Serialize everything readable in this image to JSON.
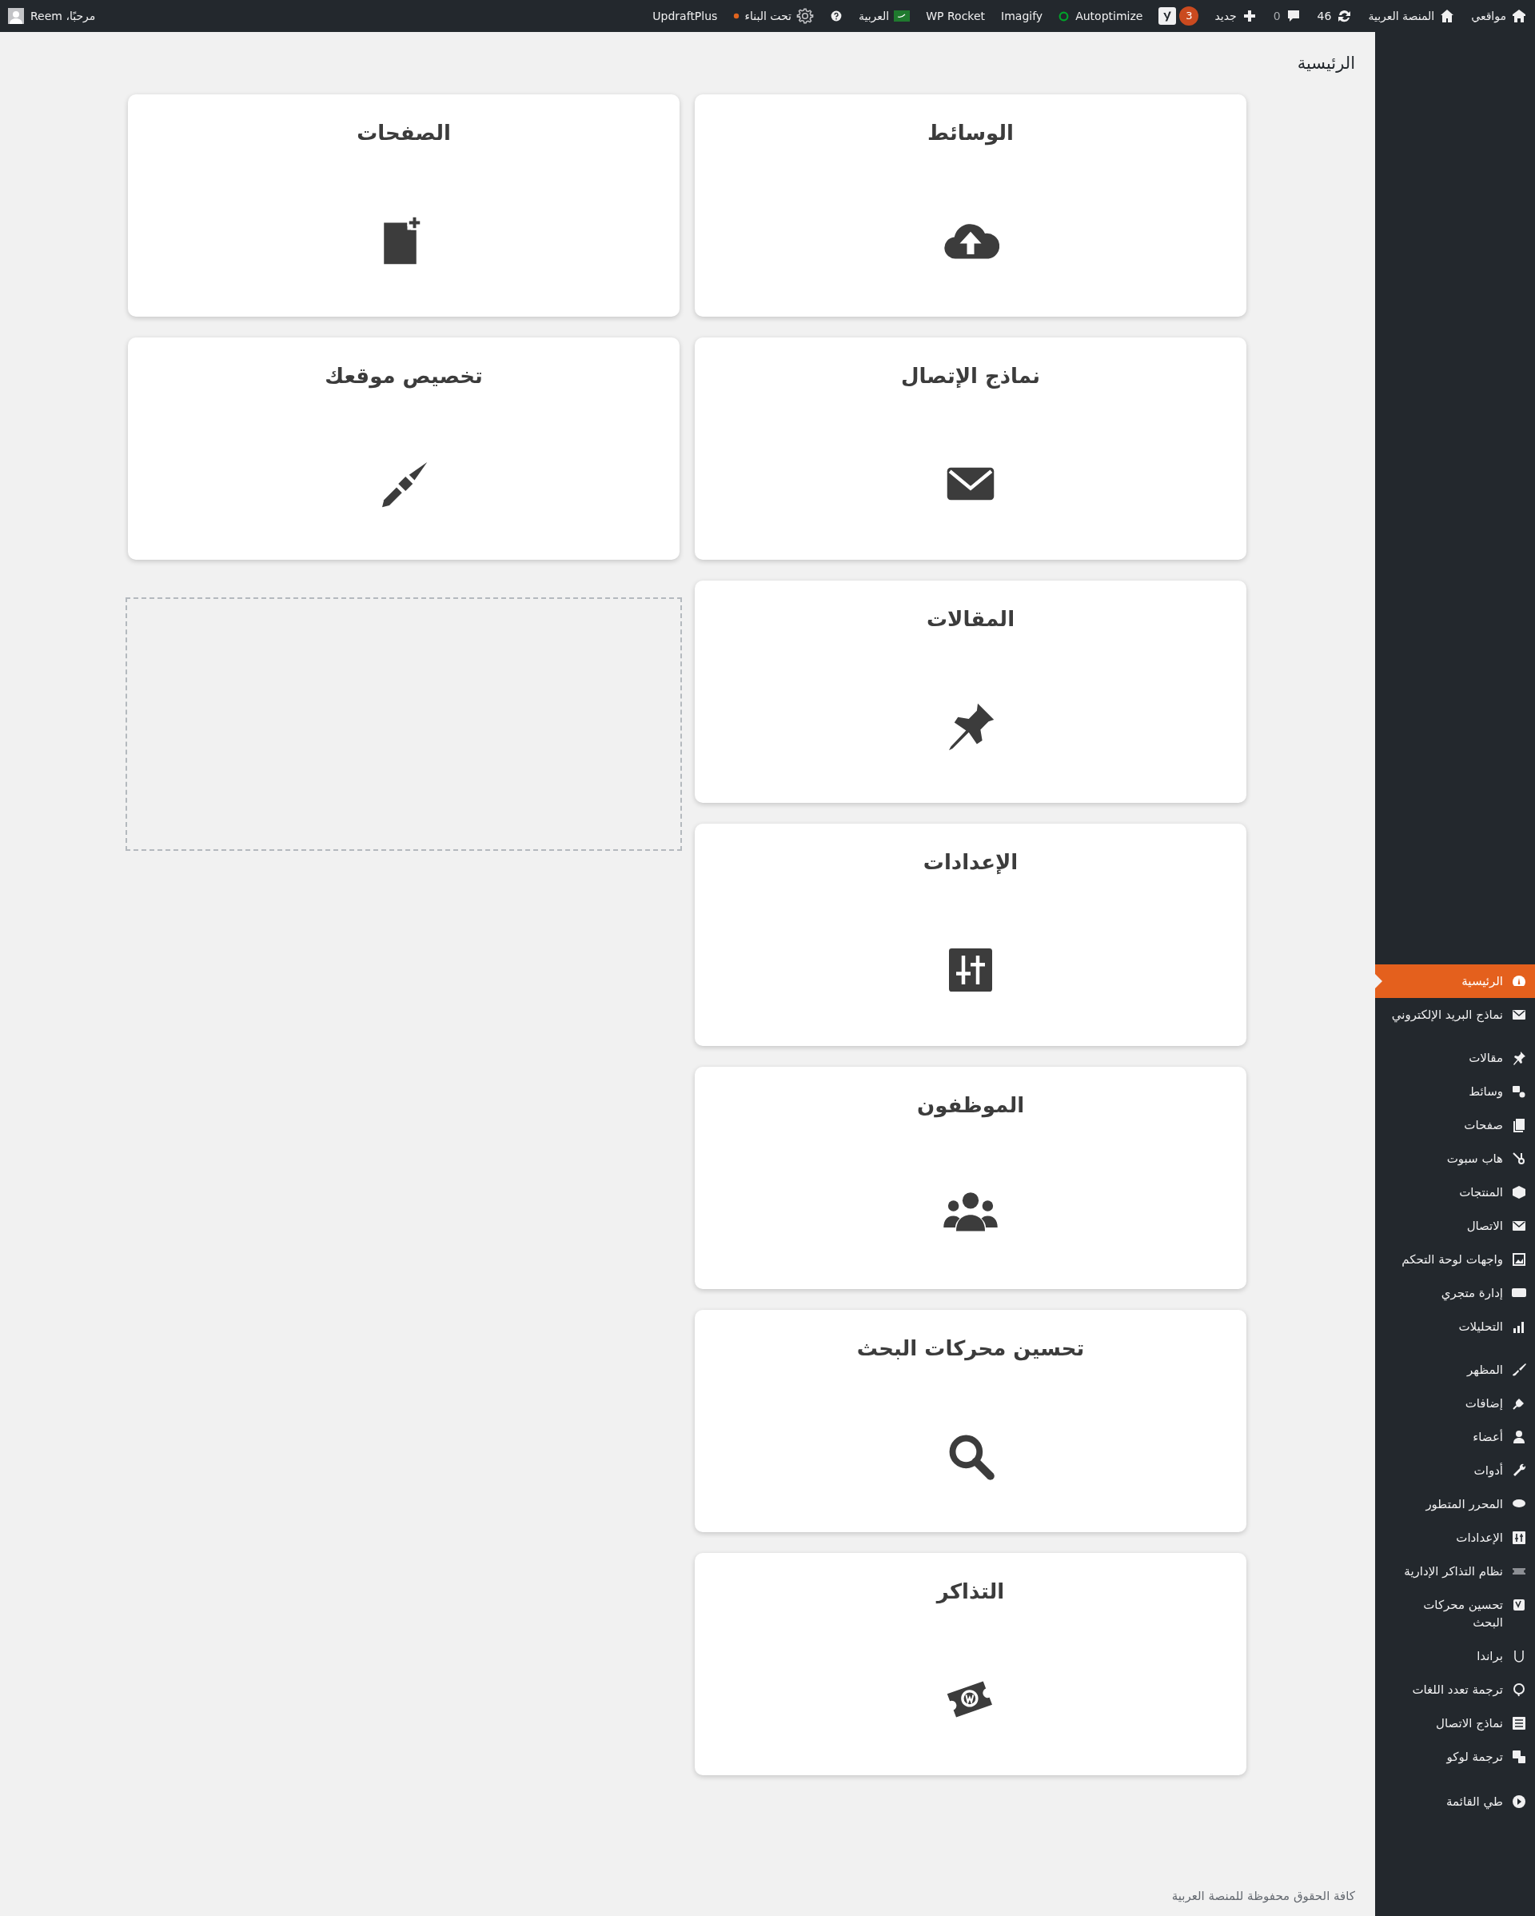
{
  "admin_bar": {
    "items": [
      {
        "kind": "menu",
        "label": "مواقعي"
      },
      {
        "kind": "menu",
        "label": "المنصة العربية"
      },
      {
        "kind": "menu",
        "label": "46"
      },
      {
        "kind": "menu",
        "label": "0"
      },
      {
        "kind": "menu",
        "label": "جديد"
      },
      {
        "kind": "badge",
        "label": "3"
      },
      {
        "kind": "status",
        "label": "Autoptimize"
      },
      {
        "kind": "menu",
        "label": "Imagify"
      },
      {
        "kind": "menu",
        "label": "WP Rocket"
      },
      {
        "kind": "flag",
        "label": "العربية"
      },
      {
        "kind": "help"
      },
      {
        "kind": "dot",
        "label": "تحت البناء"
      },
      {
        "kind": "menu",
        "label": "UpdraftPlus"
      }
    ],
    "account": "مرحبًا، Reem"
  },
  "sidebar": {
    "groups": [
      [
        {
          "label": "الرئيسية",
          "selected": true
        },
        {
          "label": "نماذج البريد الإلكتروني",
          "selected": false
        }
      ],
      [
        {
          "label": "مقالات",
          "selected": false
        },
        {
          "label": "وسائط",
          "selected": false
        },
        {
          "label": "صفحات",
          "selected": false
        },
        {
          "label": "هاب سبوت",
          "selected": false
        },
        {
          "label": "المنتجات",
          "selected": false
        },
        {
          "label": "الاتصال",
          "selected": false
        },
        {
          "label": "واجهات لوحة التحكم",
          "selected": false
        },
        {
          "label": "إدارة متجري",
          "selected": false
        },
        {
          "label": "التحليلات",
          "selected": false
        }
      ],
      [
        {
          "label": "المظهر",
          "selected": false
        },
        {
          "label": "إضافات",
          "selected": false
        },
        {
          "label": "أعضاء",
          "selected": false
        },
        {
          "label": "أدوات",
          "selected": false
        },
        {
          "label": "المحرر المتطور",
          "selected": false
        },
        {
          "label": "الإعدادات",
          "selected": false
        },
        {
          "label": "نظام التذاكر الإدارية",
          "selected": false
        },
        {
          "label": "تحسين محركات البحث",
          "selected": false
        },
        {
          "label": "براندا",
          "selected": false
        },
        {
          "label": "ترجمة تعدد اللغات",
          "selected": false
        },
        {
          "label": "نماذج الاتصال",
          "selected": false
        },
        {
          "label": "ترجمة لوكو",
          "selected": false
        }
      ]
    ],
    "collapse": "طي القائمة"
  },
  "page_title": "الرئيسية",
  "cards_right": [
    {
      "title": "الوسائط"
    },
    {
      "title": "نماذج الإتصال"
    },
    {
      "title": "المقالات"
    },
    {
      "title": "الإعدادات"
    },
    {
      "title": "الموظفون"
    },
    {
      "title": "تحسين محركات البحث"
    },
    {
      "title": "التذاكر"
    }
  ],
  "cards_left": [
    {
      "title": "الصفحات"
    },
    {
      "title": "تخصيص موقعك"
    }
  ],
  "footer": "كافة الحقوق محفوظة للمنصة العربية"
}
